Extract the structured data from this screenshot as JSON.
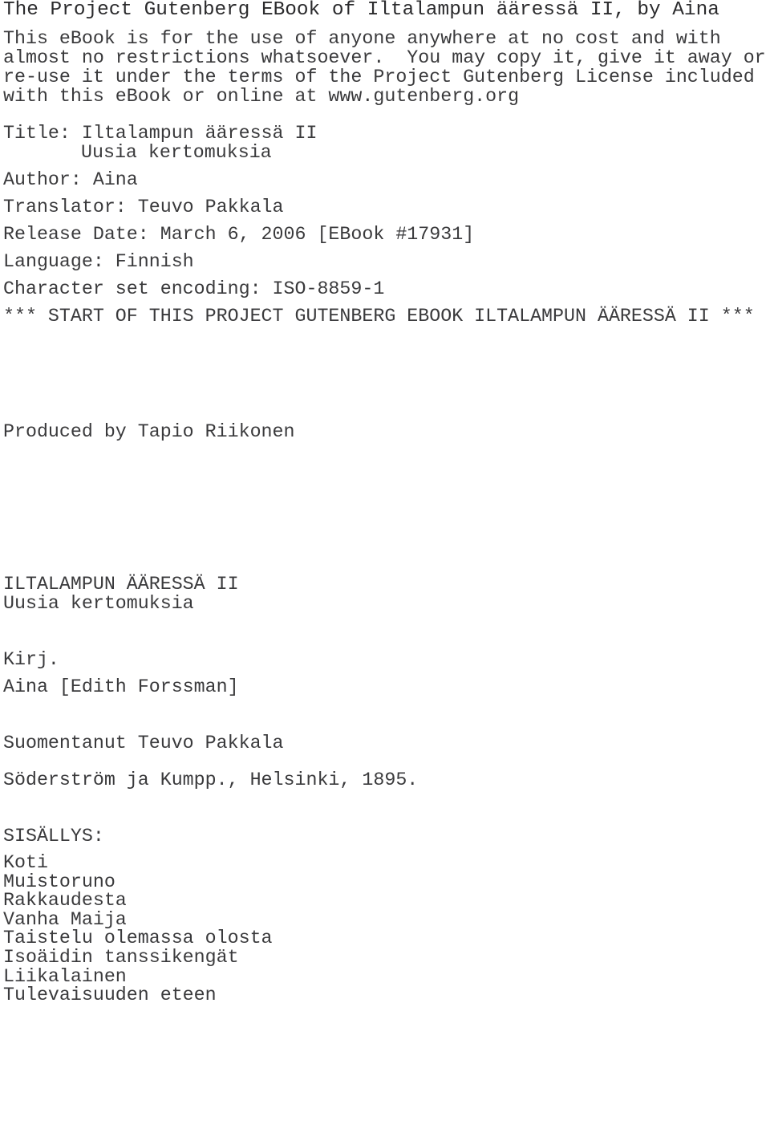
{
  "document": {
    "header_line": "The Project Gutenberg EBook of Iltalampun ääressä II, by Aina",
    "license_paragraph": [
      "This eBook is for the use of anyone anywhere at no cost and with",
      "almost no restrictions whatsoever.  You may copy it, give it away or",
      "re-use it under the terms of the Project Gutenberg License included",
      "with this eBook or online at www.gutenberg.org"
    ],
    "metadata": {
      "title_label": "Title: Iltalampun ääressä II",
      "title_subtitle": "Uusia kertomuksia",
      "author": "Author: Aina",
      "translator": "Translator: Teuvo Pakkala",
      "release_date": "Release Date: March 6, 2006 [EBook #17931]",
      "language": "Language: Finnish",
      "encoding": "Character set encoding: ISO-8859-1"
    },
    "start_marker": "*** START OF THIS PROJECT GUTENBERG EBOOK ILTALAMPUN ÄÄRESSÄ II ***",
    "producer": "Produced by Tapio Riikonen",
    "title_page": {
      "title": "ILTALAMPUN ÄÄRESSÄ II",
      "subtitle": "Uusia kertomuksia",
      "by_label": "Kirj.",
      "author": "Aina [Edith Forssman]",
      "translator_credit": "Suomentanut Teuvo Pakkala",
      "publisher": "Söderström ja Kumpp., Helsinki, 1895."
    },
    "contents": {
      "heading": "SISÄLLYS:",
      "items": [
        "Koti",
        "Muistoruno",
        "Rakkaudesta",
        "Vanha Maija",
        "Taistelu olemassa olosta",
        "Isoäidin tanssikengät",
        "Liikalainen",
        "Tulevaisuuden eteen"
      ]
    }
  },
  "colors": {
    "text": "#3a3a3c",
    "header_text": "#2b2b2d",
    "background": "#ffffff"
  }
}
